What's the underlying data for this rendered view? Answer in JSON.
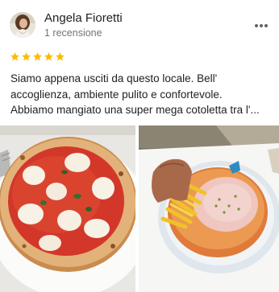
{
  "review": {
    "author_name": "Angela Fioretti",
    "author_review_count": "1 recensione",
    "rating": 5,
    "rating_max": 5,
    "star_color": "#fbbc04",
    "more_icon": "more-vert-icon",
    "text_lines": [
      "Siamo appena usciti da questo locale. Bell'",
      "accoglienza, ambiente pulito e confortevole.",
      "Abbiamo mangiato una super mega cotoletta tra l'..."
    ],
    "photos": [
      {
        "subject": "pizza"
      },
      {
        "subject": "cotoletta"
      }
    ]
  }
}
